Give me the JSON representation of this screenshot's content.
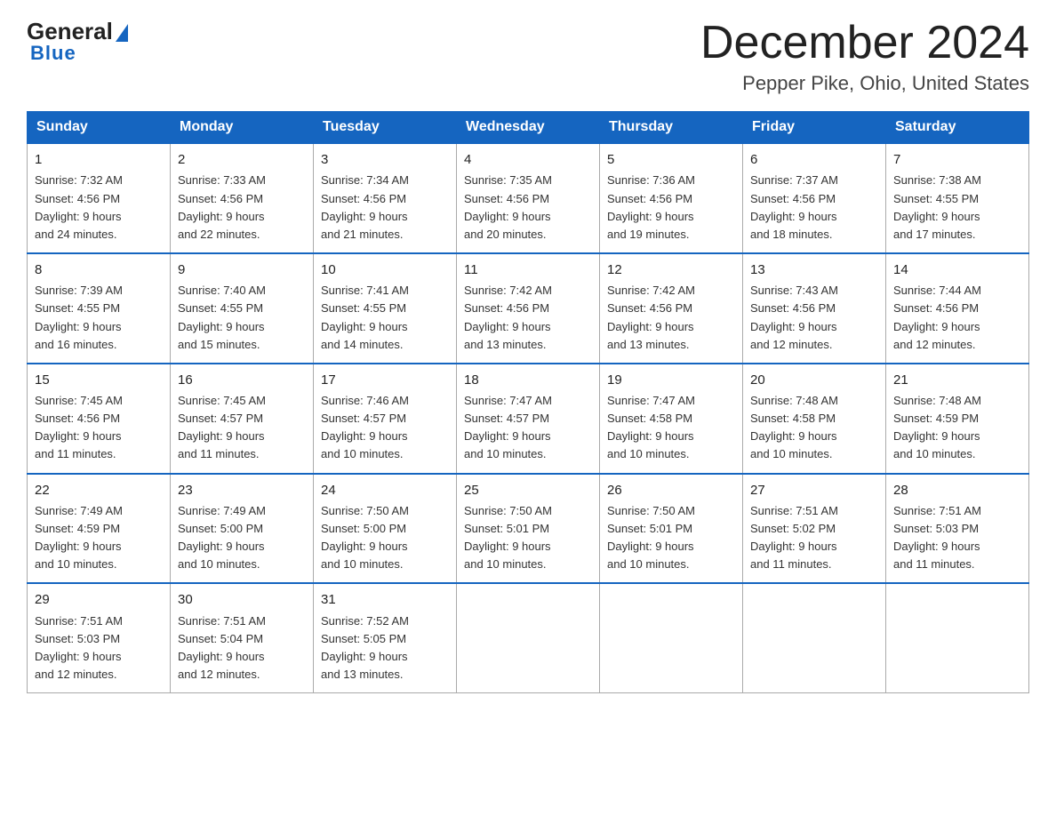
{
  "header": {
    "logo_general": "General",
    "logo_blue": "Blue",
    "month_title": "December 2024",
    "location": "Pepper Pike, Ohio, United States"
  },
  "days_of_week": [
    "Sunday",
    "Monday",
    "Tuesday",
    "Wednesday",
    "Thursday",
    "Friday",
    "Saturday"
  ],
  "weeks": [
    [
      {
        "day": 1,
        "sunrise": "7:32 AM",
        "sunset": "4:56 PM",
        "daylight": "9 hours and 24 minutes."
      },
      {
        "day": 2,
        "sunrise": "7:33 AM",
        "sunset": "4:56 PM",
        "daylight": "9 hours and 22 minutes."
      },
      {
        "day": 3,
        "sunrise": "7:34 AM",
        "sunset": "4:56 PM",
        "daylight": "9 hours and 21 minutes."
      },
      {
        "day": 4,
        "sunrise": "7:35 AM",
        "sunset": "4:56 PM",
        "daylight": "9 hours and 20 minutes."
      },
      {
        "day": 5,
        "sunrise": "7:36 AM",
        "sunset": "4:56 PM",
        "daylight": "9 hours and 19 minutes."
      },
      {
        "day": 6,
        "sunrise": "7:37 AM",
        "sunset": "4:56 PM",
        "daylight": "9 hours and 18 minutes."
      },
      {
        "day": 7,
        "sunrise": "7:38 AM",
        "sunset": "4:55 PM",
        "daylight": "9 hours and 17 minutes."
      }
    ],
    [
      {
        "day": 8,
        "sunrise": "7:39 AM",
        "sunset": "4:55 PM",
        "daylight": "9 hours and 16 minutes."
      },
      {
        "day": 9,
        "sunrise": "7:40 AM",
        "sunset": "4:55 PM",
        "daylight": "9 hours and 15 minutes."
      },
      {
        "day": 10,
        "sunrise": "7:41 AM",
        "sunset": "4:55 PM",
        "daylight": "9 hours and 14 minutes."
      },
      {
        "day": 11,
        "sunrise": "7:42 AM",
        "sunset": "4:56 PM",
        "daylight": "9 hours and 13 minutes."
      },
      {
        "day": 12,
        "sunrise": "7:42 AM",
        "sunset": "4:56 PM",
        "daylight": "9 hours and 13 minutes."
      },
      {
        "day": 13,
        "sunrise": "7:43 AM",
        "sunset": "4:56 PM",
        "daylight": "9 hours and 12 minutes."
      },
      {
        "day": 14,
        "sunrise": "7:44 AM",
        "sunset": "4:56 PM",
        "daylight": "9 hours and 12 minutes."
      }
    ],
    [
      {
        "day": 15,
        "sunrise": "7:45 AM",
        "sunset": "4:56 PM",
        "daylight": "9 hours and 11 minutes."
      },
      {
        "day": 16,
        "sunrise": "7:45 AM",
        "sunset": "4:57 PM",
        "daylight": "9 hours and 11 minutes."
      },
      {
        "day": 17,
        "sunrise": "7:46 AM",
        "sunset": "4:57 PM",
        "daylight": "9 hours and 10 minutes."
      },
      {
        "day": 18,
        "sunrise": "7:47 AM",
        "sunset": "4:57 PM",
        "daylight": "9 hours and 10 minutes."
      },
      {
        "day": 19,
        "sunrise": "7:47 AM",
        "sunset": "4:58 PM",
        "daylight": "9 hours and 10 minutes."
      },
      {
        "day": 20,
        "sunrise": "7:48 AM",
        "sunset": "4:58 PM",
        "daylight": "9 hours and 10 minutes."
      },
      {
        "day": 21,
        "sunrise": "7:48 AM",
        "sunset": "4:59 PM",
        "daylight": "9 hours and 10 minutes."
      }
    ],
    [
      {
        "day": 22,
        "sunrise": "7:49 AM",
        "sunset": "4:59 PM",
        "daylight": "9 hours and 10 minutes."
      },
      {
        "day": 23,
        "sunrise": "7:49 AM",
        "sunset": "5:00 PM",
        "daylight": "9 hours and 10 minutes."
      },
      {
        "day": 24,
        "sunrise": "7:50 AM",
        "sunset": "5:00 PM",
        "daylight": "9 hours and 10 minutes."
      },
      {
        "day": 25,
        "sunrise": "7:50 AM",
        "sunset": "5:01 PM",
        "daylight": "9 hours and 10 minutes."
      },
      {
        "day": 26,
        "sunrise": "7:50 AM",
        "sunset": "5:01 PM",
        "daylight": "9 hours and 10 minutes."
      },
      {
        "day": 27,
        "sunrise": "7:51 AM",
        "sunset": "5:02 PM",
        "daylight": "9 hours and 11 minutes."
      },
      {
        "day": 28,
        "sunrise": "7:51 AM",
        "sunset": "5:03 PM",
        "daylight": "9 hours and 11 minutes."
      }
    ],
    [
      {
        "day": 29,
        "sunrise": "7:51 AM",
        "sunset": "5:03 PM",
        "daylight": "9 hours and 12 minutes."
      },
      {
        "day": 30,
        "sunrise": "7:51 AM",
        "sunset": "5:04 PM",
        "daylight": "9 hours and 12 minutes."
      },
      {
        "day": 31,
        "sunrise": "7:52 AM",
        "sunset": "5:05 PM",
        "daylight": "9 hours and 13 minutes."
      },
      null,
      null,
      null,
      null
    ]
  ],
  "labels": {
    "sunrise": "Sunrise:",
    "sunset": "Sunset:",
    "daylight": "Daylight:"
  }
}
